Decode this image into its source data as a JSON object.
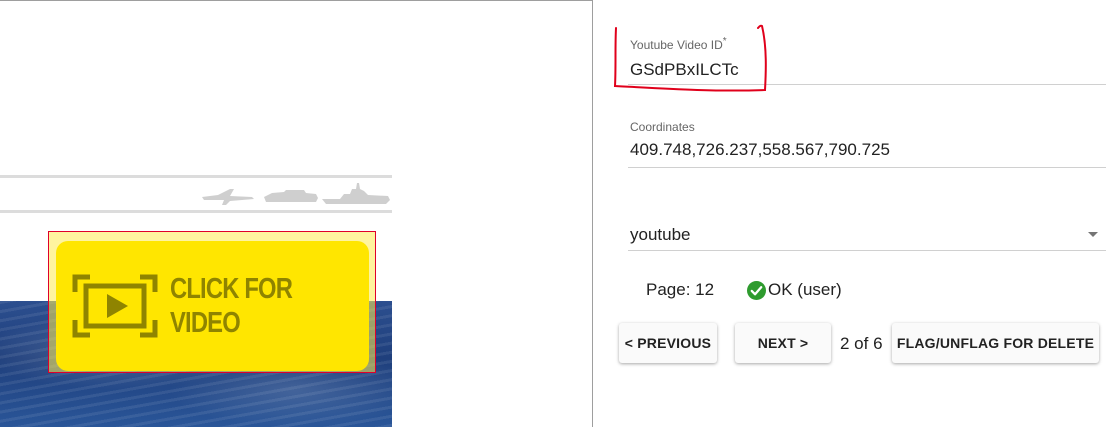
{
  "preview": {
    "video_overlay": {
      "line1": "CLICK FOR",
      "line2": "VIDEO"
    }
  },
  "form": {
    "youtube_id": {
      "label": "Youtube Video ID",
      "required_mark": "*",
      "value": "GSdPBxILCTc"
    },
    "coordinates": {
      "label": "Coordinates",
      "value": "409.748,726.237,558.567,790.725"
    },
    "type_select": {
      "selected": "youtube"
    }
  },
  "status": {
    "page_label": "Page: 12",
    "ok_text": "OK (user)"
  },
  "nav": {
    "previous_label": "< PREVIOUS",
    "next_label": "NEXT >",
    "position_text": "2 of 6",
    "flag_label": "FLAG/UNFLAG FOR DELETE"
  },
  "colors": {
    "annotation": "#e0001b",
    "ok_green": "#2e9b2e",
    "video_yellow": "#ffe600",
    "sea_blue": "#1f3f7c"
  }
}
